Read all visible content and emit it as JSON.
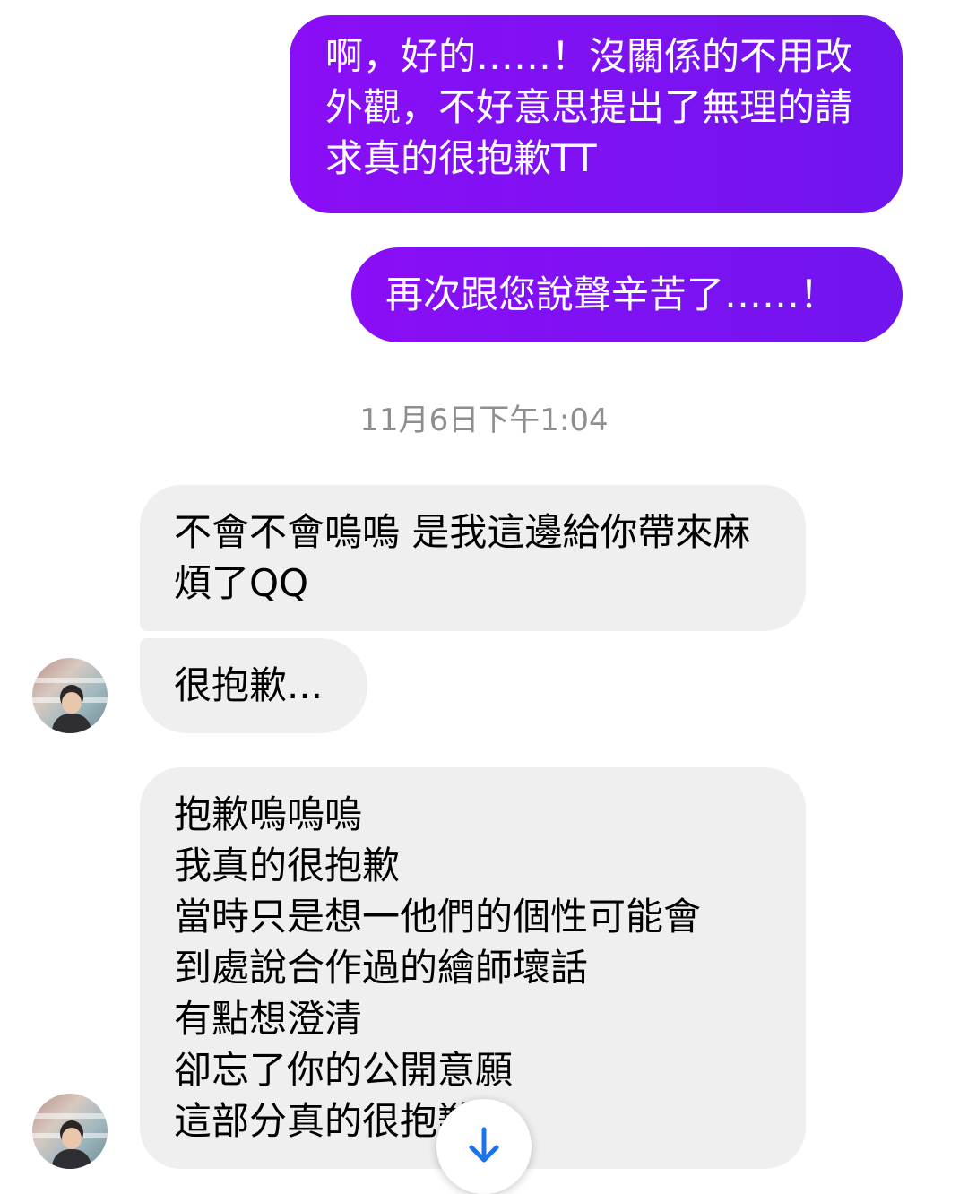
{
  "thread": {
    "sent_messages": [
      "啊，好的……！沒關係的不用改外觀，不好意思提出了無理的請求真的很抱歉TT",
      "再次跟您說聲辛苦了……！"
    ],
    "timestamp": "11月6日下午1:04",
    "received_messages": [
      "不會不會嗚嗚 是我這邊給你帶來麻煩了QQ",
      "很抱歉...",
      "抱歉嗚嗚嗚\n我真的很抱歉\n當時只是想一他們的個性可能會\n到處說合作過的繪師壞話\n有點想澄清\n卻忘了你的公開意願\n這部分真的很抱歉..."
    ]
  },
  "icons": {
    "avatar": "user-avatar-photo",
    "scroll_down": "arrow-down-icon"
  },
  "colors": {
    "sent_bubble_start": "#8a0ef7",
    "sent_bubble_end": "#7015ee",
    "received_bubble": "#efefef",
    "timestamp_text": "#8e8e8e",
    "scroll_arrow": "#1a73e8"
  }
}
